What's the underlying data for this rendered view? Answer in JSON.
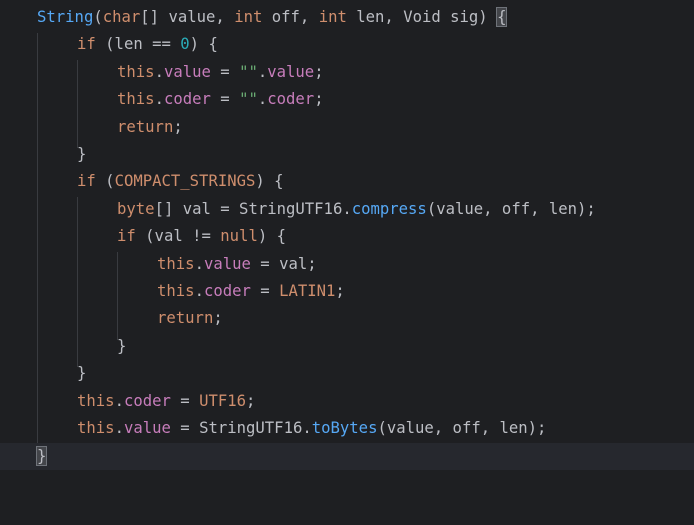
{
  "colors": {
    "background": "#1e1f22",
    "current_line": "#26282e",
    "default_text": "#bcbec4",
    "keyword": "#cf8e6d",
    "field": "#c77dbb",
    "string": "#6aab73",
    "number": "#2aacb8",
    "method": "#56a8f5",
    "indent_guide": "#393b40",
    "brace_match": "#43454a"
  },
  "code": {
    "l0": {
      "t1": "String",
      "t2": "(",
      "t3": "char",
      "t4": "[] value, ",
      "t5": "int",
      "t6": " off, ",
      "t7": "int",
      "t8": " len, Void sig) ",
      "t9": "{"
    },
    "l1": {
      "t1": "if",
      "t2": " (len == ",
      "t3": "0",
      "t4": ") {"
    },
    "l2": {
      "t1": "this",
      "t2": ".",
      "t3": "value",
      "t4": " = ",
      "t5": "\"\"",
      "t6": ".",
      "t7": "value",
      "t8": ";"
    },
    "l3": {
      "t1": "this",
      "t2": ".",
      "t3": "coder",
      "t4": " = ",
      "t5": "\"\"",
      "t6": ".",
      "t7": "coder",
      "t8": ";"
    },
    "l4": {
      "t1": "return",
      "t2": ";"
    },
    "l5": {
      "t1": "}"
    },
    "l6": {
      "t1": "if",
      "t2": " (",
      "t3": "COMPACT_STRINGS",
      "t4": ") {"
    },
    "l7": {
      "t1": "byte",
      "t2": "[] val = StringUTF16.",
      "t3": "compress",
      "t4": "(value, off, len);"
    },
    "l8": {
      "t1": "if",
      "t2": " (val != ",
      "t3": "null",
      "t4": ") {"
    },
    "l9": {
      "t1": "this",
      "t2": ".",
      "t3": "value",
      "t4": " = val;"
    },
    "l10": {
      "t1": "this",
      "t2": ".",
      "t3": "coder",
      "t4": " = ",
      "t5": "LATIN1",
      "t6": ";"
    },
    "l11": {
      "t1": "return",
      "t2": ";"
    },
    "l12": {
      "t1": "}"
    },
    "l13": {
      "t1": "}"
    },
    "l14": {
      "t1": "this",
      "t2": ".",
      "t3": "coder",
      "t4": " = ",
      "t5": "UTF16",
      "t6": ";"
    },
    "l15": {
      "t1": "this",
      "t2": ".",
      "t3": "value",
      "t4": " = StringUTF16.",
      "t5": "toBytes",
      "t6": "(value, off, len);"
    },
    "l16": {
      "t1": "}"
    }
  }
}
